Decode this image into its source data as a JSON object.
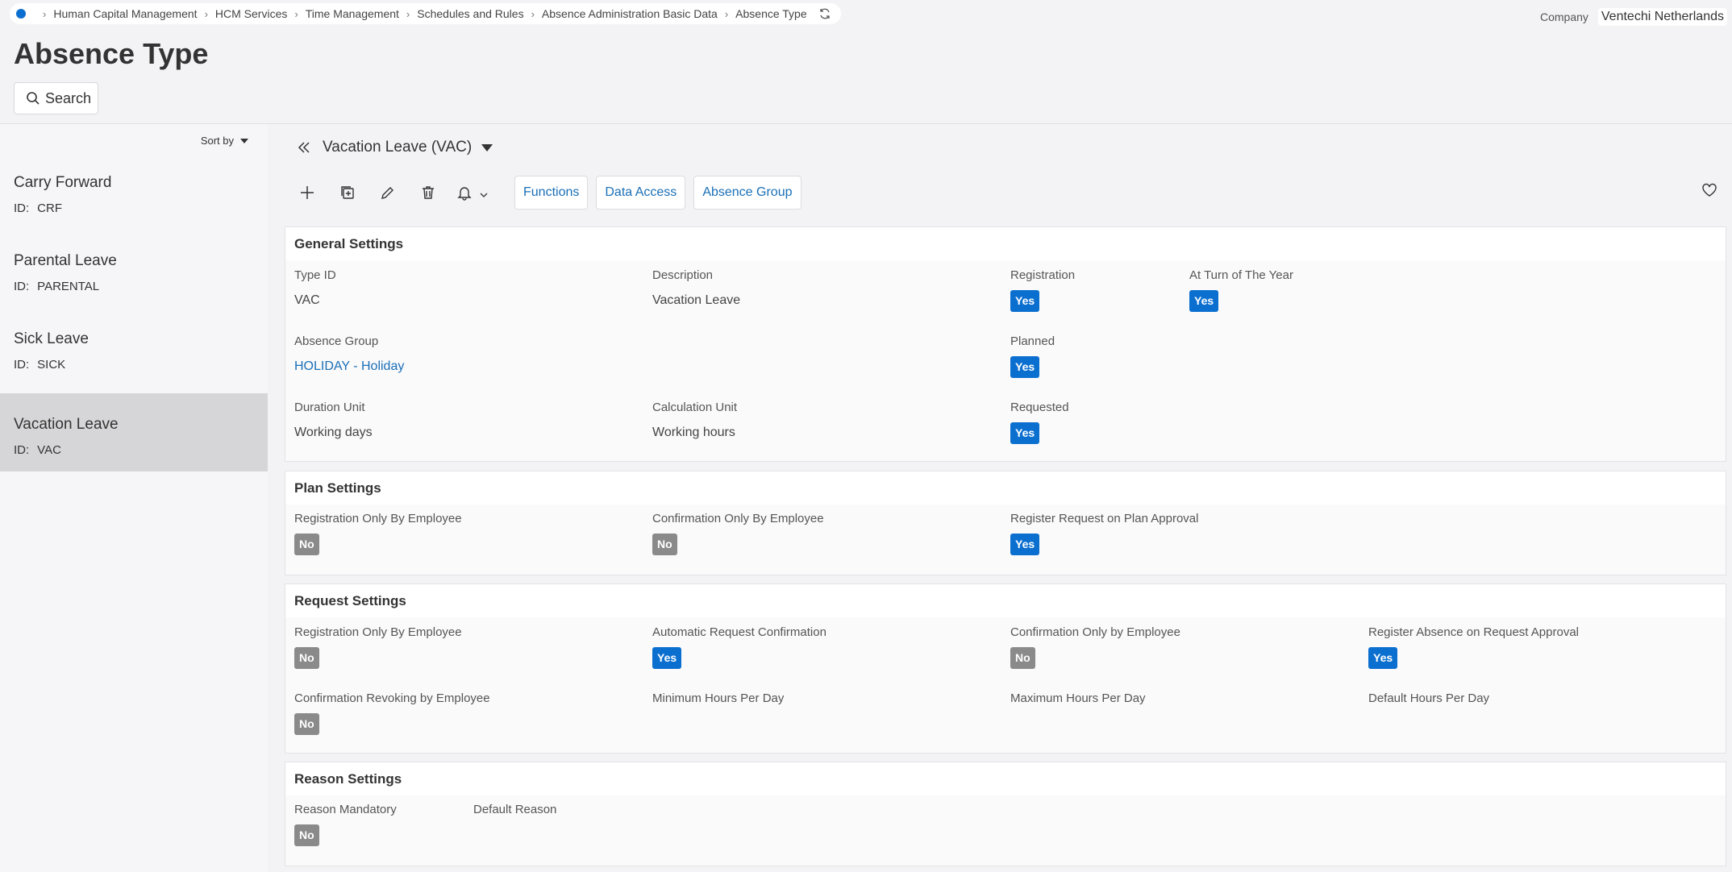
{
  "breadcrumb": {
    "items": [
      "Human Capital Management",
      "HCM Services",
      "Time Management",
      "Schedules and Rules",
      "Absence Administration Basic Data",
      "Absence Type"
    ]
  },
  "company": {
    "label": "Company",
    "value": "Ventechi Netherlands"
  },
  "page": {
    "title": "Absence Type",
    "search_label": "Search"
  },
  "list": {
    "sort_label": "Sort by",
    "id_prefix": "ID:",
    "items": [
      {
        "name": "Carry Forward",
        "id": "CRF"
      },
      {
        "name": "Parental Leave",
        "id": "PARENTAL"
      },
      {
        "name": "Sick Leave",
        "id": "SICK"
      },
      {
        "name": "Vacation Leave",
        "id": "VAC"
      }
    ]
  },
  "record": {
    "title": "Vacation Leave (VAC)",
    "toolbar": {
      "functions": "Functions",
      "data_access": "Data Access",
      "absence_group": "Absence Group"
    }
  },
  "general": {
    "title": "General Settings",
    "type_id_label": "Type ID",
    "type_id": "VAC",
    "description_label": "Description",
    "description": "Vacation Leave",
    "registration_label": "Registration",
    "registration": "Yes",
    "turn_of_year_label": "At Turn of The Year",
    "turn_of_year": "Yes",
    "absence_group_label": "Absence Group",
    "absence_group": "HOLIDAY - Holiday",
    "planned_label": "Planned",
    "planned": "Yes",
    "duration_unit_label": "Duration Unit",
    "duration_unit": "Working days",
    "calculation_unit_label": "Calculation Unit",
    "calculation_unit": "Working hours",
    "requested_label": "Requested",
    "requested": "Yes"
  },
  "plan": {
    "title": "Plan Settings",
    "reg_only_emp_label": "Registration Only By Employee",
    "reg_only_emp": "No",
    "conf_only_emp_label": "Confirmation Only By Employee",
    "conf_only_emp": "No",
    "register_request_label": "Register Request on Plan Approval",
    "register_request": "Yes"
  },
  "request": {
    "title": "Request Settings",
    "reg_only_emp_label": "Registration Only By Employee",
    "reg_only_emp": "No",
    "auto_confirm_label": "Automatic Request Confirmation",
    "auto_confirm": "Yes",
    "conf_only_emp_label": "Confirmation Only by Employee",
    "conf_only_emp": "No",
    "register_absence_label": "Register Absence on Request Approval",
    "register_absence": "Yes",
    "conf_revoking_label": "Confirmation Revoking by Employee",
    "conf_revoking": "No",
    "min_hours_label": "Minimum Hours Per Day",
    "max_hours_label": "Maximum Hours Per Day",
    "default_hours_label": "Default Hours Per Day"
  },
  "reason": {
    "title": "Reason Settings",
    "mandatory_label": "Reason Mandatory",
    "mandatory": "No",
    "default_label": "Default Reason"
  },
  "colors": {
    "accent": "#0b6fd0",
    "link": "#1a6fb6",
    "no_badge": "#8a8a8a"
  }
}
